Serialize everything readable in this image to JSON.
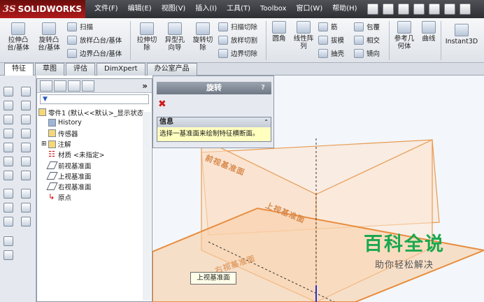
{
  "app": {
    "brand": "SOLIDWORKS",
    "brand_prefix": "3S"
  },
  "menu": [
    "文件(F)",
    "编辑(E)",
    "视图(V)",
    "插入(I)",
    "工具(T)",
    "Toolbox",
    "窗口(W)",
    "帮助(H)"
  ],
  "commands": {
    "extrude_boss": "拉伸凸\n台/基体",
    "revolve_boss": "旋转凸\n台/基体",
    "sweep": "扫描",
    "loft_boss": "放样凸台/基体",
    "boundary_boss": "边界凸台/基体",
    "extrude_cut": "拉伸切\n除",
    "hole_wizard": "异型孔\n向导",
    "revolve_cut": "旋转切\n除",
    "sweep_cut": "扫描切除",
    "loft_cut": "放样切割",
    "boundary_cut": "边界切除",
    "fillet": "圆角",
    "linear_pattern": "线性阵\n列",
    "rib": "筋",
    "draft": "拔模",
    "shell": "抽壳",
    "wrap": "包覆",
    "intersect": "相交",
    "mirror": "镜向",
    "ref_geometry": "参考几\n何体",
    "curves": "曲线",
    "instant3d": "Instant3D"
  },
  "tabs": [
    "特征",
    "草图",
    "评估",
    "DimXpert",
    "办公室产品"
  ],
  "feature_tree": {
    "root": "零件1 (默认<<默认>_显示状态",
    "items": [
      "History",
      "传感器",
      "注解",
      "材质 <未指定>",
      "前视基准面",
      "上视基准面",
      "右视基准面",
      "原点"
    ]
  },
  "property_manager": {
    "title": "旋转",
    "help": "?",
    "cancel": "✖",
    "info_header": "信息",
    "info_collapse": "⌃",
    "info_message": "选择一基准面来绘制特征横断面。"
  },
  "viewport": {
    "front_plane_label": "前视基准面",
    "top_plane_label": "上视基准面",
    "right_plane_label": "右视基准面",
    "tooltip": "上视基准面"
  },
  "watermark": {
    "main": "百科全说",
    "sub": "助你轻松解决"
  },
  "colors": {
    "plane": "#e8a060",
    "accent": "#1aa84e",
    "titlebar": "#3a3b40"
  }
}
